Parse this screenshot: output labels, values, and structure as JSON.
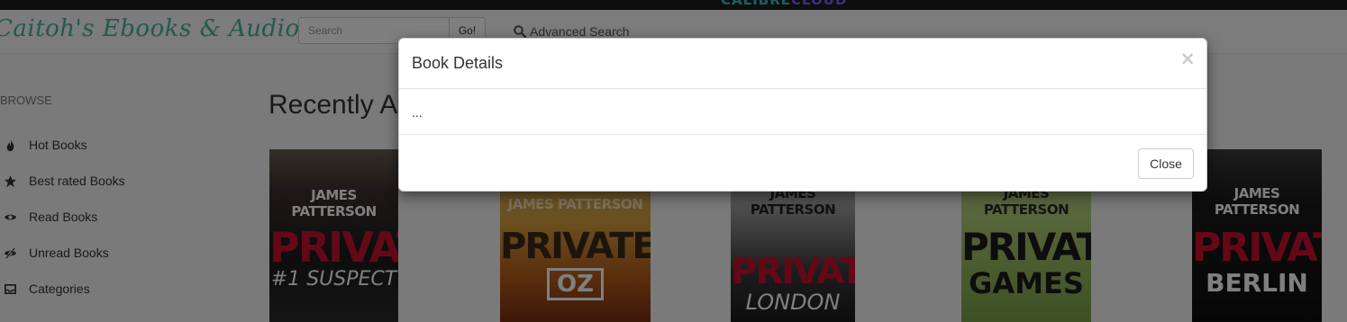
{
  "topbar": {
    "logo_text": "CALIBRE",
    "logo_accent": "CLOUD"
  },
  "navbar": {
    "brand": "Caitoh's Ebooks & Audiobooks",
    "search_placeholder": "Search",
    "go_label": "Go!",
    "advanced_search_label": "Advanced Search"
  },
  "sidebar": {
    "heading": "BROWSE",
    "items": [
      {
        "label": "Hot Books",
        "icon": "fire-icon"
      },
      {
        "label": "Best rated Books",
        "icon": "star-icon"
      },
      {
        "label": "Read Books",
        "icon": "eye-icon"
      },
      {
        "label": "Unread Books",
        "icon": "eye-slash-icon"
      },
      {
        "label": "Categories",
        "icon": "inbox-icon"
      }
    ]
  },
  "main": {
    "section_title": "Recently Added Books",
    "covers": [
      {
        "author": "JAMES PATTERSON",
        "title": "PRIVATE",
        "sub": "#1 SUSPECT"
      },
      {
        "author": "JAMES PATTERSON",
        "title": "PRIVATE",
        "sub": "OZ"
      },
      {
        "author": "JAMES PATTERSON",
        "title": "PRIVATE",
        "sub": "LONDON"
      },
      {
        "author": "JAMES PATTERSON",
        "title": "PRIVATE",
        "sub": "GAMES"
      },
      {
        "author": "JAMES PATTERSON",
        "title": "PRIVATE",
        "sub": "BERLIN"
      }
    ]
  },
  "modal": {
    "title": "Book Details",
    "close_symbol": "×",
    "body": "...",
    "close_label": "Close"
  },
  "colors": {
    "brand": "#45b29d",
    "backdrop": "#000000",
    "cover_red": "#c8102e"
  }
}
